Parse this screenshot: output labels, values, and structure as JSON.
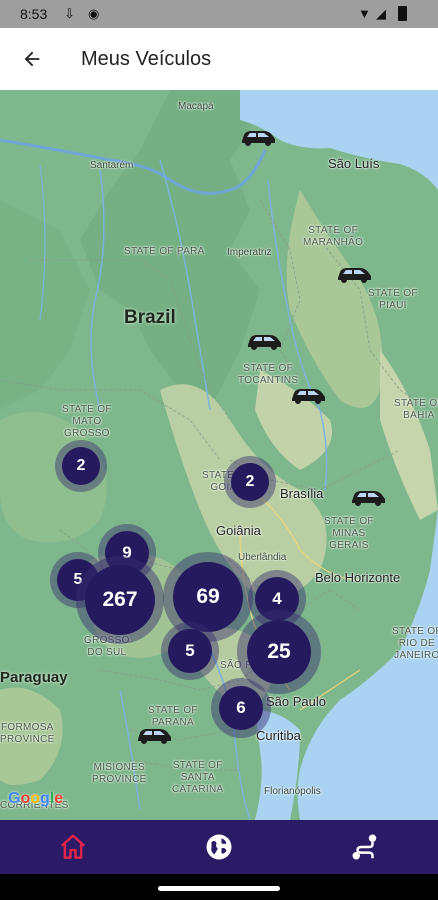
{
  "status_bar": {
    "time": "8:53"
  },
  "app_bar": {
    "title": "Meus Veículos"
  },
  "map": {
    "country_labels": [
      "Brazil",
      "Paraguay"
    ],
    "city_labels": {
      "macapa": "Macapá",
      "santarem": "Santarém",
      "sao_luis": "São Luís",
      "imperatriz": "Imperatriz",
      "brasilia": "Brasília",
      "goiania": "Goiânia",
      "uberlandia": "Uberlândia",
      "belo_horizonte": "Belo Horizonte",
      "sao_paulo": "São Paulo",
      "curitiba": "Curitiba",
      "florianopolis": "Florianópolis"
    },
    "state_labels": {
      "para": "STATE OF PARÁ",
      "maranhao": "STATE OF\nMARANHÃO",
      "piaui": "STATE OF\nPIAUÍ",
      "tocantins": "STATE OF\nTOCANTINS",
      "bahia": "STATE OF\nBAHIA",
      "mato_grosso": "STATE OF\nMATO\nGROSSO",
      "goias": "STATE OF\nGOIÁS",
      "minas": "STATE OF\nMINAS\nGERAIS",
      "mato_grosso_sul": "GROSSO\nDO SUL",
      "sao_paulo": "SÃO P",
      "rio": "STATE OF\nRIO DE\nJANEIRO",
      "parana": "STATE OF\nPARANÁ",
      "santa_catarina": "STATE OF\nSANTA\nCATARINA",
      "formosa": "FORMOSA\nPROVINCE",
      "misiones": "MISIONES\nPROVINCE",
      "corrientes": "CORRIENTES"
    },
    "clusters": [
      "2",
      "2",
      "9",
      "5",
      "267",
      "69",
      "4",
      "5",
      "25",
      "6"
    ],
    "attribution": "Google"
  },
  "bottom_nav": {
    "items": [
      {
        "icon": "home-icon",
        "active": true
      },
      {
        "icon": "globe-icon",
        "active": false
      },
      {
        "icon": "route-icon",
        "active": false
      }
    ],
    "active_color": "#e0244a",
    "inactive_color": "#ffffff"
  },
  "colors": {
    "nav_background": "#2b1a66",
    "cluster": "#261a5e"
  }
}
